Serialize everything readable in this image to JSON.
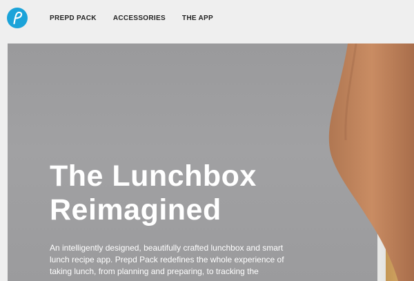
{
  "header": {
    "logo_icon": "prepd-logo-icon",
    "brand_color": "#1ba3d9",
    "nav": [
      {
        "label": "PREPD PACK"
      },
      {
        "label": "ACCESSORIES"
      },
      {
        "label": "THE APP"
      }
    ]
  },
  "hero": {
    "headline_line1": "The Lunchbox",
    "headline_line2": "Reimagined",
    "description": "An intelligently designed, beautifully crafted lunchbox and smart lunch recipe app. Prepd Pack redefines the whole experience of taking lunch, from planning and preparing, to tracking the"
  }
}
